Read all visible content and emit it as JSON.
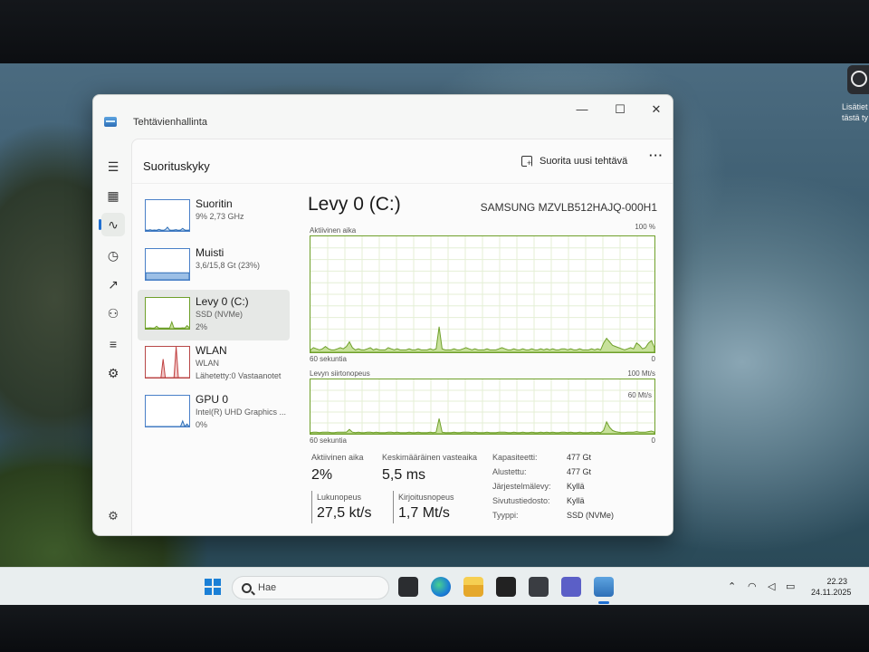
{
  "desktop": {
    "corner_widget_text": "Lisätiet\ntästä ty"
  },
  "window": {
    "title": "Tehtävienhallinta",
    "controls": {
      "minimize": "—",
      "maximize": "☐",
      "close": "✕"
    }
  },
  "header": {
    "page_title": "Suorituskyky",
    "new_task_label": "Suorita uusi tehtävä",
    "more_label": "···"
  },
  "devices": [
    {
      "name": "Suoritin",
      "sub1": "9% 2,73 GHz",
      "sub2": "",
      "border": "#4a80c8",
      "fill": "#cfe0f3",
      "line": "#2f6fb7"
    },
    {
      "name": "Muisti",
      "sub1": "3,6/15,8 Gt (23%)",
      "sub2": "",
      "border": "#4a80c8",
      "fill": "#9cbfe6",
      "line": "#2f6fb7"
    },
    {
      "name": "Levy 0 (C:)",
      "sub1": "SSD (NVMe)",
      "sub2": "2%",
      "border": "#6fa02a",
      "fill": "#c9e29d",
      "line": "#6fa02a"
    },
    {
      "name": "WLAN",
      "sub1": "WLAN",
      "sub2": "Lähetetty:0 Vastaanotet",
      "border": "#b84848",
      "fill": "#f1c7c7",
      "line": "#c04040"
    },
    {
      "name": "GPU 0",
      "sub1": "Intel(R) UHD Graphics ...",
      "sub2": "0%",
      "border": "#4a80c8",
      "fill": "#cfe0f3",
      "line": "#2f6fb7"
    }
  ],
  "detail": {
    "title": "Levy 0 (C:)",
    "model": "SAMSUNG MZVLB512HAJQ-000H1",
    "graph1": {
      "label": "Aktiivinen aika",
      "max": "100 %",
      "time": "60 sekuntia",
      "min": "0"
    },
    "graph2": {
      "label": "Levyn siirtonopeus",
      "max": "100 Mt/s",
      "inner": "60 Mt/s",
      "time": "60 sekuntia",
      "min": "0"
    },
    "stats": {
      "active_label": "Aktiivinen aika",
      "active_value": "2%",
      "response_label": "Keskimääräinen vasteaika",
      "response_value": "5,5 ms",
      "read_label": "Lukunopeus",
      "read_value": "27,5 kt/s",
      "write_label": "Kirjoitusnopeus",
      "write_value": "1,7 Mt/s"
    },
    "properties": [
      {
        "key": "Kapasiteetti:",
        "value": "477 Gt"
      },
      {
        "key": "Alustettu:",
        "value": "477 Gt"
      },
      {
        "key": "Järjestelmälevy:",
        "value": "Kyllä"
      },
      {
        "key": "Sivutustiedosto:",
        "value": "Kyllä"
      },
      {
        "key": "Tyyppi:",
        "value": "SSD (NVMe)"
      }
    ]
  },
  "chart_data": [
    {
      "type": "area",
      "series": [
        {
          "values": [
            2,
            4,
            3,
            2,
            3,
            5,
            3,
            2,
            2,
            3,
            4,
            3,
            5,
            9,
            4,
            2,
            3,
            2,
            2,
            3,
            4,
            2,
            3,
            2,
            2,
            2,
            4,
            3,
            2,
            3,
            2,
            2,
            2,
            3,
            2,
            2,
            3,
            2,
            2,
            2,
            3,
            2,
            3,
            22,
            3,
            2,
            2,
            2,
            3,
            2,
            2,
            3,
            4,
            3,
            2,
            3,
            2,
            2,
            2,
            3,
            2,
            2,
            2,
            3,
            4,
            3,
            2,
            2,
            3,
            2,
            2,
            3,
            2,
            2,
            3,
            2,
            2,
            3,
            2,
            3,
            2,
            3,
            2,
            2,
            3,
            3,
            2,
            3,
            2,
            2,
            3,
            2,
            2,
            2,
            3,
            2,
            3,
            2,
            8,
            12,
            9,
            6,
            5,
            4,
            3,
            2,
            3,
            4,
            3,
            8,
            6,
            3,
            4,
            8,
            10,
            4
          ]
        }
      ],
      "ylim": [
        0,
        100
      ]
    },
    {
      "type": "area",
      "series": [
        {
          "values": [
            2,
            3,
            3,
            2,
            3,
            3,
            3,
            2,
            2,
            3,
            3,
            3,
            3,
            8,
            3,
            2,
            3,
            2,
            2,
            3,
            3,
            2,
            3,
            2,
            2,
            2,
            3,
            3,
            2,
            3,
            2,
            2,
            2,
            3,
            2,
            2,
            3,
            2,
            2,
            2,
            3,
            2,
            3,
            28,
            3,
            2,
            2,
            2,
            3,
            2,
            2,
            3,
            3,
            3,
            2,
            3,
            2,
            2,
            2,
            3,
            2,
            2,
            2,
            3,
            3,
            3,
            2,
            2,
            3,
            2,
            2,
            3,
            2,
            2,
            3,
            2,
            2,
            3,
            2,
            3,
            2,
            3,
            2,
            2,
            3,
            3,
            2,
            3,
            2,
            2,
            3,
            2,
            2,
            2,
            3,
            2,
            3,
            2,
            6,
            22,
            12,
            6,
            4,
            3,
            2,
            2,
            3,
            3,
            3,
            4,
            3,
            3,
            3,
            4,
            5,
            3
          ]
        }
      ],
      "ylim": [
        0,
        100
      ]
    }
  ],
  "taskbar": {
    "search_placeholder": "Hae",
    "time": "22.23",
    "date": "24.11.2025"
  }
}
